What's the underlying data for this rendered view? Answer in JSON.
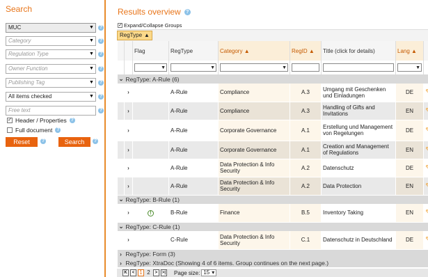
{
  "sidebar": {
    "title": "Search",
    "dropdowns": [
      {
        "value": "MUC",
        "placeholder": ""
      },
      {
        "value": "",
        "placeholder": "Category"
      },
      {
        "value": "",
        "placeholder": "Regulation Type"
      },
      {
        "value": "",
        "placeholder": "Owner Function"
      },
      {
        "value": "",
        "placeholder": "Publishing Tag"
      },
      {
        "value": "All items checked",
        "placeholder": ""
      }
    ],
    "free_text_placeholder": "Free text",
    "header_properties_label": "Header / Properties",
    "full_document_label": "Full document",
    "reset_label": "Reset",
    "search_label": "Search"
  },
  "main": {
    "title": "Results overview",
    "expand_label": "Expand/Collapse Groups",
    "group_chip": "RegType",
    "columns": {
      "flag": "Flag",
      "regtype": "RegType",
      "category": "Category",
      "regid": "RegID",
      "title": "Title (click for details)",
      "lang": "Lang"
    },
    "groups": [
      {
        "label": "RegType: A-Rule (6)",
        "rows": [
          {
            "flag": "",
            "regtype": "A-Rule",
            "category": "Compliance",
            "regid": "A.3",
            "title": "Umgang mit Geschenken und Einladungen",
            "lang": "DE"
          },
          {
            "flag": "",
            "regtype": "A-Rule",
            "category": "Compliance",
            "regid": "A.3",
            "title": "Handling of Gifts and Invitations",
            "lang": "EN"
          },
          {
            "flag": "",
            "regtype": "A-Rule",
            "category": "Corporate Governance",
            "regid": "A.1",
            "title": "Erstellung und Management von Regelungen",
            "lang": "DE"
          },
          {
            "flag": "",
            "regtype": "A-Rule",
            "category": "Corporate Governance",
            "regid": "A.1",
            "title": "Creation and Management of Regulations",
            "lang": "EN"
          },
          {
            "flag": "",
            "regtype": "A-Rule",
            "category": "Data Protection & Info Security",
            "regid": "A.2",
            "title": "Datenschutz",
            "lang": "DE"
          },
          {
            "flag": "",
            "regtype": "A-Rule",
            "category": "Data Protection & Info Security",
            "regid": "A.2",
            "title": "Data Protection",
            "lang": "EN"
          }
        ]
      },
      {
        "label": "RegType: B-Rule (1)",
        "rows": [
          {
            "flag": "!",
            "regtype": "B-Rule",
            "category": "Finance",
            "regid": "B.5",
            "title": "Inventory Taking",
            "lang": "EN"
          }
        ]
      },
      {
        "label": "RegType: C-Rule (1)",
        "rows": [
          {
            "flag": "",
            "regtype": "C-Rule",
            "category": "Data Protection & Info Security",
            "regid": "C.1",
            "title": "Datenschutz in Deutschland",
            "lang": "DE"
          }
        ]
      },
      {
        "label": "RegType: Form (3)",
        "collapsed": true,
        "rows": []
      },
      {
        "label": "RegType: XtraDoc (Showing 4 of 6 items. Group continues on the next page.)",
        "collapsed": true,
        "rows": []
      }
    ]
  },
  "pager": {
    "pages": [
      "1",
      "2"
    ],
    "current": "1",
    "size_label": "Page size:",
    "size_value": "15"
  },
  "colors": {
    "accent": "#e8751a",
    "button": "#e8630f",
    "group_chip": "#fbd98a"
  }
}
